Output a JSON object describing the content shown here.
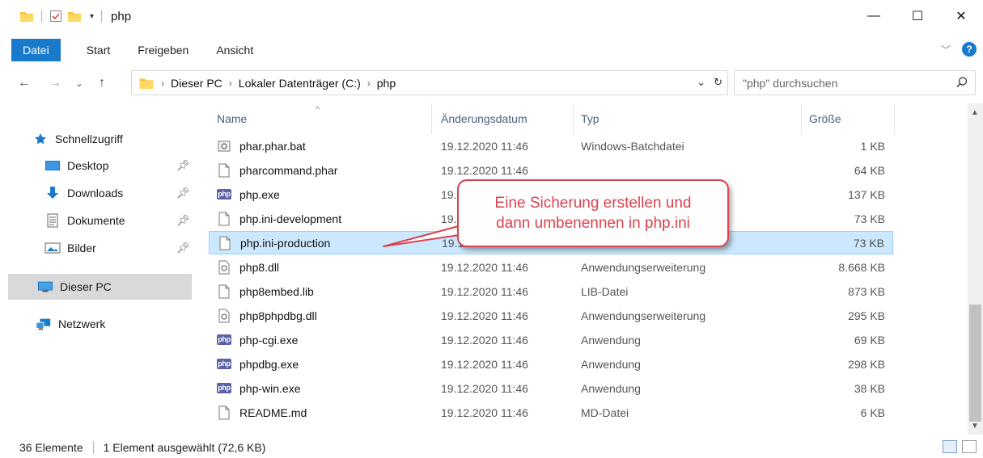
{
  "window": {
    "title": "php",
    "minimize_glyph": "—",
    "maximize_glyph": "☐",
    "close_glyph": "✕"
  },
  "ribbon": {
    "tabs": [
      {
        "label": "Datei",
        "active": true
      },
      {
        "label": "Start"
      },
      {
        "label": "Freigeben"
      },
      {
        "label": "Ansicht"
      }
    ]
  },
  "address": {
    "crumbs": [
      "Dieser PC",
      "Lokaler Datenträger (C:)",
      "php"
    ],
    "search_placeholder": "\"php\" durchsuchen"
  },
  "navpane": {
    "items": [
      {
        "label": "Schnellzugriff",
        "icon": "star-icon"
      },
      {
        "label": "Desktop",
        "icon": "desktop-icon",
        "pinned": true
      },
      {
        "label": "Downloads",
        "icon": "download-icon",
        "pinned": true
      },
      {
        "label": "Dokumente",
        "icon": "documents-icon",
        "pinned": true
      },
      {
        "label": "Bilder",
        "icon": "pictures-icon",
        "pinned": true
      },
      {
        "label": "Dieser PC",
        "icon": "computer-icon",
        "selected": true
      },
      {
        "label": "Netzwerk",
        "icon": "network-icon"
      }
    ]
  },
  "columns": {
    "name": "Name",
    "date": "Änderungsdatum",
    "type": "Typ",
    "size": "Größe"
  },
  "files": [
    {
      "name": "phar.phar.bat",
      "date": "19.12.2020 11:46",
      "type": "Windows-Batchdatei",
      "size": "1 KB",
      "icon": "batch-file-icon"
    },
    {
      "name": "pharcommand.phar",
      "date": "19.12.2020 11:46",
      "type": "",
      "size": "64 KB",
      "icon": "file-icon"
    },
    {
      "name": "php.exe",
      "date": "19.12.2020 11:46",
      "type": "",
      "size": "137 KB",
      "icon": "php-icon"
    },
    {
      "name": "php.ini-development",
      "date": "19.12.2020 11:46",
      "type": "",
      "size": "73 KB",
      "icon": "file-icon"
    },
    {
      "name": "php.ini-production",
      "date": "19.12.2020 11:46",
      "type": "",
      "size": "73 KB",
      "icon": "file-icon",
      "selected": true
    },
    {
      "name": "php8.dll",
      "date": "19.12.2020 11:46",
      "type": "Anwendungserweiterung",
      "size": "8.668 KB",
      "icon": "dll-icon"
    },
    {
      "name": "php8embed.lib",
      "date": "19.12.2020 11:46",
      "type": "LIB-Datei",
      "size": "873 KB",
      "icon": "file-icon"
    },
    {
      "name": "php8phpdbg.dll",
      "date": "19.12.2020 11:46",
      "type": "Anwendungserweiterung",
      "size": "295 KB",
      "icon": "dll-icon"
    },
    {
      "name": "php-cgi.exe",
      "date": "19.12.2020 11:46",
      "type": "Anwendung",
      "size": "69 KB",
      "icon": "php-icon"
    },
    {
      "name": "phpdbg.exe",
      "date": "19.12.2020 11:46",
      "type": "Anwendung",
      "size": "298 KB",
      "icon": "php-icon"
    },
    {
      "name": "php-win.exe",
      "date": "19.12.2020 11:46",
      "type": "Anwendung",
      "size": "38 KB",
      "icon": "php-icon"
    },
    {
      "name": "README.md",
      "date": "19.12.2020 11:46",
      "type": "MD-Datei",
      "size": "6 KB",
      "icon": "file-icon"
    }
  ],
  "status": {
    "count": "36 Elemente",
    "selection": "1 Element ausgewählt (72,6 KB)"
  },
  "callout": {
    "line1": "Eine Sicherung erstellen und",
    "line2": "dann umbenennen in php.ini"
  },
  "colors": {
    "accent": "#1979ca",
    "selection_bg": "#cce8ff",
    "callout_red": "#d9434e",
    "header_text": "#4c607a"
  }
}
